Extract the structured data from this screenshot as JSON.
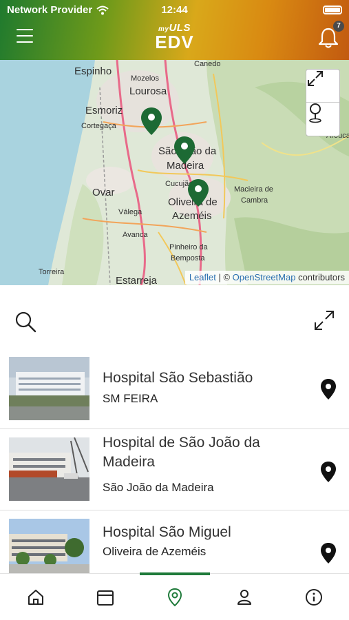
{
  "status": {
    "carrier": "Network Provider",
    "time": "12:44"
  },
  "header": {
    "logo_top_small": "my",
    "logo_top": "ULS",
    "logo_main": "EDV",
    "notification_count": "7"
  },
  "map": {
    "places": [
      "Espinho",
      "Canedo",
      "Mozelos",
      "Lourosa",
      "Esmoriz",
      "Cortegaça",
      "São João da",
      "Madeira",
      "Cucujães",
      "Oliveira de",
      "Azeméis",
      "Ovar",
      "Válega",
      "Macieira de",
      "Cambra",
      "Avanca",
      "Pinheiro da",
      "Bemposta",
      "Torreira",
      "Estarreja",
      "Arouca"
    ],
    "attribution": {
      "leaflet": "Leaflet",
      "separator": " | © ",
      "osm": "OpenStreetMap",
      "suffix": " contributors"
    }
  },
  "hospitals": [
    {
      "name": "Hospital São Sebastião",
      "location": "SM FEIRA"
    },
    {
      "name": "Hospital de São João da Madeira",
      "location": "São João da Madeira"
    },
    {
      "name": "Hospital São Miguel",
      "location": "Oliveira de Azeméis"
    }
  ],
  "colors": {
    "accent": "#1f7a3a",
    "marker": "#1d6a34"
  },
  "icons": {
    "nav": [
      "home-icon",
      "calendar-icon",
      "location-pin-icon",
      "user-icon",
      "info-icon"
    ]
  }
}
